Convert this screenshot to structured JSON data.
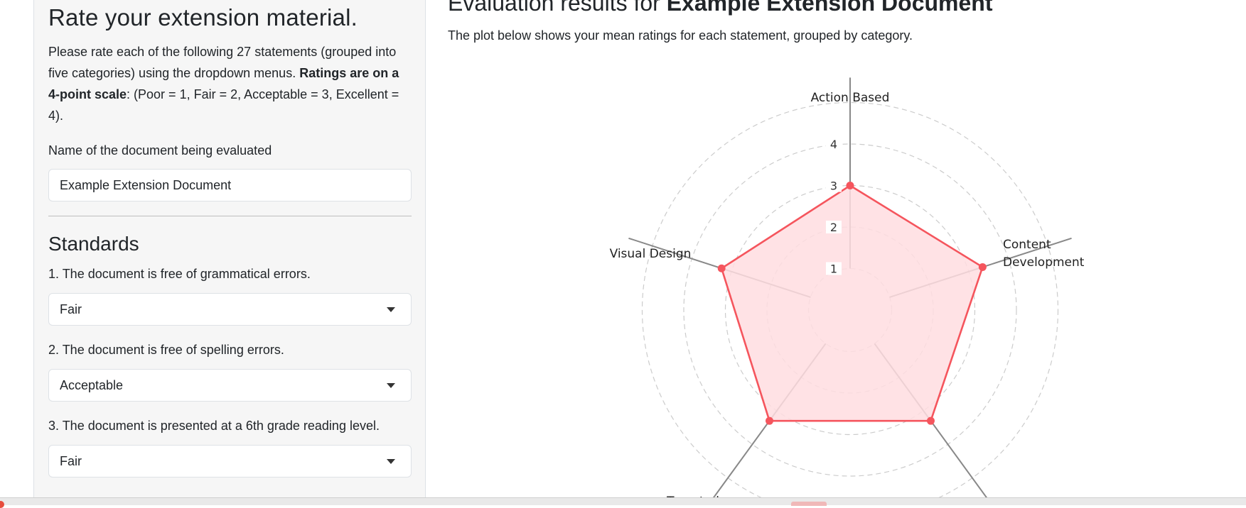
{
  "sidebar": {
    "title": "Rate your extension material.",
    "intro_part1": "Please rate each of the following 27 statements (grouped into five categories) using the dropdown menus. ",
    "intro_bold": "Ratings are on a 4-point scale",
    "intro_part2": ": (Poor = 1, Fair = 2, Acceptable = 3, Excellent = 4).",
    "doc_name_label": "Name of the document being evaluated",
    "doc_name_value": "Example Extension Document",
    "section_title": "Standards",
    "questions": [
      {
        "label": "1. The document is free of grammatical errors.",
        "selected": "Fair"
      },
      {
        "label": "2. The document is free of spelling errors.",
        "selected": "Acceptable"
      },
      {
        "label": "3. The document is presented at a 6th grade reading level.",
        "selected": "Fair"
      }
    ]
  },
  "main": {
    "heading_prefix": "Evaluation results for ",
    "heading_doc": "Example Extension Document",
    "subtitle": "The plot below shows your mean ratings for each statement, grouped by category."
  },
  "colors": {
    "series_line": "#f5555d",
    "series_fill": "#ffdde0",
    "grid": "#cccccc",
    "spoke": "#888888"
  },
  "chart_data": {
    "type": "radar",
    "categories": [
      "Action Based",
      "Content Development",
      "",
      "Targeted",
      "Visual Design"
    ],
    "category_label_lines": [
      [
        "Action Based"
      ],
      [
        "Content",
        "Development"
      ],
      [
        ""
      ],
      [
        "Targeted"
      ],
      [
        "Visual Design"
      ]
    ],
    "values": [
      3.0,
      3.35,
      3.3,
      3.3,
      3.25
    ],
    "radial_ticks": [
      1,
      2,
      3,
      4
    ],
    "rlim": [
      0,
      5
    ],
    "grid": "dashed"
  }
}
